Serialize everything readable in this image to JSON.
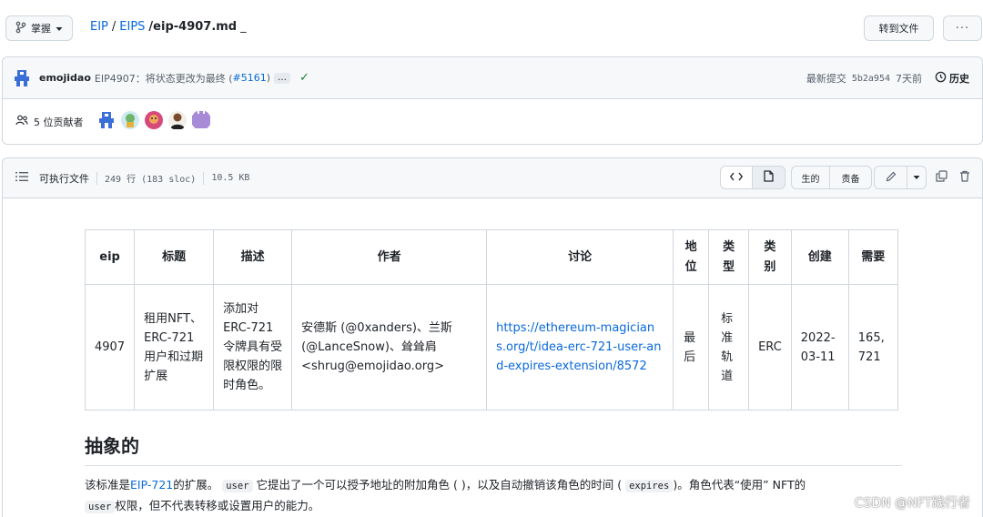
{
  "header": {
    "branch_label": "掌握",
    "breadcrumb": {
      "repo": "EIP",
      "sep1": "/",
      "folder": "EIPS",
      "file": "/eip-4907.md",
      "trail": "_"
    },
    "goto_file_label": "转到文件",
    "more_label": "···"
  },
  "commit": {
    "author": "emojidao",
    "message": "EIP4907：将状态更改为最终 (",
    "pr": "#5161",
    "message_end": ")",
    "ellipsis": "…",
    "latest_label": "最新提交",
    "hash": "5b2a954",
    "time": "7天前",
    "history_label": "历史"
  },
  "contributors": {
    "label": "5 位贡献者"
  },
  "file": {
    "type_label": "可执行文件",
    "lines": "249 行 (183 sloc)",
    "size": "10.5 KB",
    "raw_label": "生的",
    "blame_label": "责备"
  },
  "meta_table": {
    "headers": [
      "eip",
      "标题",
      "描述",
      "作者",
      "讨论",
      "地位",
      "类型",
      "类别",
      "创建",
      "需要"
    ],
    "row": {
      "eip": "4907",
      "title": "租用NFT、ERC-721用户和过期扩展",
      "description": "添加对ERC-721令牌具有受限权限的限时角色。",
      "author": "安德斯 (@0xanders)、兰斯 (@LanceSnow)、耸耸肩 <shrug@emojidao.org>",
      "discussion": "https://ethereum-magicians.org/t/idea-erc-721-user-and-expires-extension/8572",
      "status": "最后",
      "type": "标准轨道",
      "category": "ERC",
      "created": "2022-03-11",
      "requires": "165, 721"
    }
  },
  "abstract": {
    "heading": "抽象的",
    "p1": "该标准是",
    "link": "EIP-721",
    "p2": "的扩展。",
    "code1": "user",
    "p3": "它提出了一个可以授予地址的附加角色 ( )，以及自动撤销该角色的时间 (",
    "code2": "expires",
    "p4": ")。角色代表“使用” NFT的",
    "code3": "user",
    "p5": "权限，但不代表转移或设置用户的能力。"
  },
  "watermark": "CSDN @NFT践行者",
  "colors": {
    "link": "#0969da",
    "border": "#d0d7de",
    "header_bg": "#f6f8fa",
    "check": "#1a7f37"
  }
}
